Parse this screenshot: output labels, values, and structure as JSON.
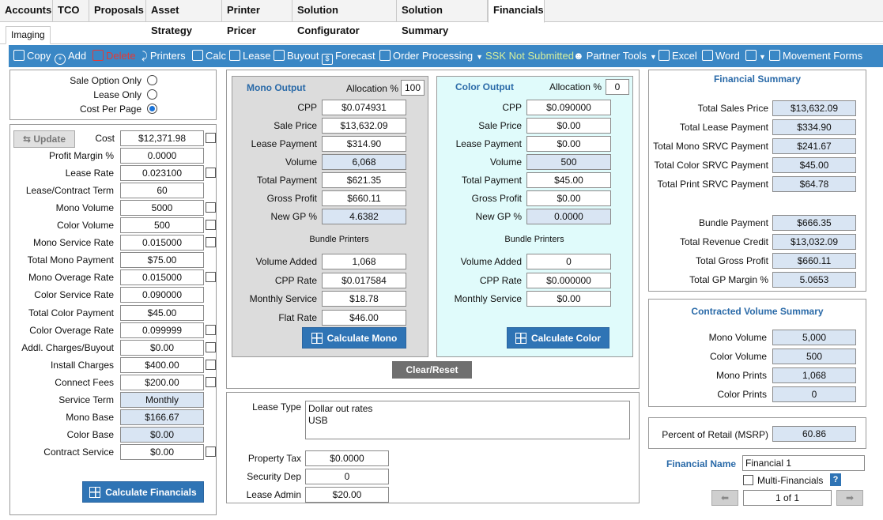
{
  "top_tabs": [
    "Accounts",
    "TCO",
    "Proposals",
    "Asset Strategy",
    "Printer Pricer",
    "Solution Configurator",
    "Solution Summary",
    "Financials"
  ],
  "sub_tab": "Imaging",
  "toolbar": {
    "copy": "Copy",
    "add": "Add",
    "delete": "Delete",
    "printers": "Printers",
    "calc": "Calc",
    "lease": "Lease",
    "buyout": "Buyout",
    "forecast": "Forecast",
    "order_processing": "Order Processing",
    "ssk_status": "SSK Not Submitted",
    "partner_tools": "Partner Tools",
    "excel": "Excel",
    "word": "Word",
    "movement_forms": "Movement Forms"
  },
  "sale_options": {
    "sale_option_only": "Sale Option Only",
    "lease_only": "Lease Only",
    "cost_per_page": "Cost Per Page",
    "selected": "Cost Per Page"
  },
  "left": {
    "update_label": "Update",
    "calc_financials": "Calculate Financials",
    "fields": [
      {
        "label": "Cost",
        "value": "$12,371.98"
      },
      {
        "label": "Profit Margin %",
        "value": "0.0000"
      },
      {
        "label": "Lease Rate",
        "value": "0.023100"
      },
      {
        "label": "Lease/Contract Term",
        "value": "60"
      },
      {
        "label": "Mono Volume",
        "value": "5000"
      },
      {
        "label": "Color Volume",
        "value": "500"
      },
      {
        "label": "Mono Service Rate",
        "value": "0.015000"
      },
      {
        "label": "Total Mono Payment",
        "value": "$75.00"
      },
      {
        "label": "Mono Overage Rate",
        "value": "0.015000"
      },
      {
        "label": "Color Service Rate",
        "value": "0.090000"
      },
      {
        "label": "Total Color Payment",
        "value": "$45.00"
      },
      {
        "label": "Color Overage Rate",
        "value": "0.099999"
      },
      {
        "label": "Addl. Charges/Buyout",
        "value": "$0.00"
      },
      {
        "label": "Install Charges",
        "value": "$400.00"
      },
      {
        "label": "Connect Fees",
        "value": "$200.00"
      },
      {
        "label": "Service Term",
        "value": "Monthly"
      },
      {
        "label": "Mono Base",
        "value": "$166.67"
      },
      {
        "label": "Color Base",
        "value": "$0.00"
      },
      {
        "label": "Contract Service",
        "value": "$0.00"
      }
    ]
  },
  "mono": {
    "title": "Mono Output",
    "alloc_label": "Allocation %",
    "alloc_value": "100",
    "fields": [
      {
        "label": "CPP",
        "value": "$0.074931"
      },
      {
        "label": "Sale Price",
        "value": "$13,632.09"
      },
      {
        "label": "Lease Payment",
        "value": "$314.90"
      },
      {
        "label": "Volume",
        "value": "6,068"
      },
      {
        "label": "Total Payment",
        "value": "$621.35"
      },
      {
        "label": "Gross Profit",
        "value": "$660.11"
      },
      {
        "label": "New GP %",
        "value": "4.6382"
      }
    ],
    "bundle_title": "Bundle Printers",
    "bundle": [
      {
        "label": "Volume Added",
        "value": "1,068"
      },
      {
        "label": "CPP Rate",
        "value": "$0.017584"
      },
      {
        "label": "Monthly Service",
        "value": "$18.78"
      },
      {
        "label": "Flat Rate",
        "value": "$46.00"
      }
    ],
    "calc_label": "Calculate Mono"
  },
  "color": {
    "title": "Color Output",
    "alloc_label": "Allocation %",
    "alloc_value": "0",
    "fields": [
      {
        "label": "CPP",
        "value": "$0.090000"
      },
      {
        "label": "Sale Price",
        "value": "$0.00"
      },
      {
        "label": "Lease Payment",
        "value": "$0.00"
      },
      {
        "label": "Volume",
        "value": "500"
      },
      {
        "label": "Total Payment",
        "value": "$45.00"
      },
      {
        "label": "Gross Profit",
        "value": "$0.00"
      },
      {
        "label": "New GP %",
        "value": "0.0000"
      }
    ],
    "bundle_title": "Bundle Printers",
    "bundle": [
      {
        "label": "Volume Added",
        "value": "0"
      },
      {
        "label": "CPP Rate",
        "value": "$0.000000"
      },
      {
        "label": "Monthly Service",
        "value": "$0.00"
      }
    ],
    "calc_label": "Calculate Color"
  },
  "clear_reset": "Clear/Reset",
  "lease_section": {
    "lease_type_label": "Lease Type",
    "lease_type_lines": [
      "Dollar out rates",
      "USB"
    ],
    "fields": [
      {
        "label": "Property Tax",
        "value": "$0.0000"
      },
      {
        "label": "Security Dep",
        "value": "0"
      },
      {
        "label": "Lease Admin",
        "value": "$20.00"
      }
    ]
  },
  "financial_summary": {
    "title": "Financial Summary",
    "fields": [
      {
        "label": "Total Sales Price",
        "value": "$13,632.09"
      },
      {
        "label": "Total Lease Payment",
        "value": "$334.90"
      },
      {
        "label": "Total Mono SRVC Payment",
        "value": "$241.67"
      },
      {
        "label": "Total Color SRVC Payment",
        "value": "$45.00"
      },
      {
        "label": "Total Print SRVC Payment",
        "value": "$64.78"
      },
      {
        "label": "Bundle Payment",
        "value": "$666.35"
      },
      {
        "label": "Total Revenue Credit",
        "value": "$13,032.09"
      },
      {
        "label": "Total Gross Profit",
        "value": "$660.11"
      },
      {
        "label": "Total GP Margin %",
        "value": "5.0653"
      }
    ]
  },
  "volume_summary": {
    "title": "Contracted Volume Summary",
    "fields": [
      {
        "label": "Mono Volume",
        "value": "5,000"
      },
      {
        "label": "Color Volume",
        "value": "500"
      },
      {
        "label": "Mono Prints",
        "value": "1,068"
      },
      {
        "label": "Color Prints",
        "value": "0"
      }
    ]
  },
  "msrp": {
    "label": "Percent of Retail (MSRP)",
    "value": "60.86"
  },
  "financial_name": {
    "label": "Financial Name",
    "value": "Financial 1"
  },
  "multi_financials": "Multi-Financials",
  "help": "?",
  "pager": "1 of 1",
  "colors": {
    "toolbar": "#3a87c5",
    "button": "#2f74b5",
    "title": "#2a6aa8",
    "readonly": "#d9e5f3",
    "color_panel": "#e0fbfb",
    "mono_panel": "#dcdcdc"
  }
}
